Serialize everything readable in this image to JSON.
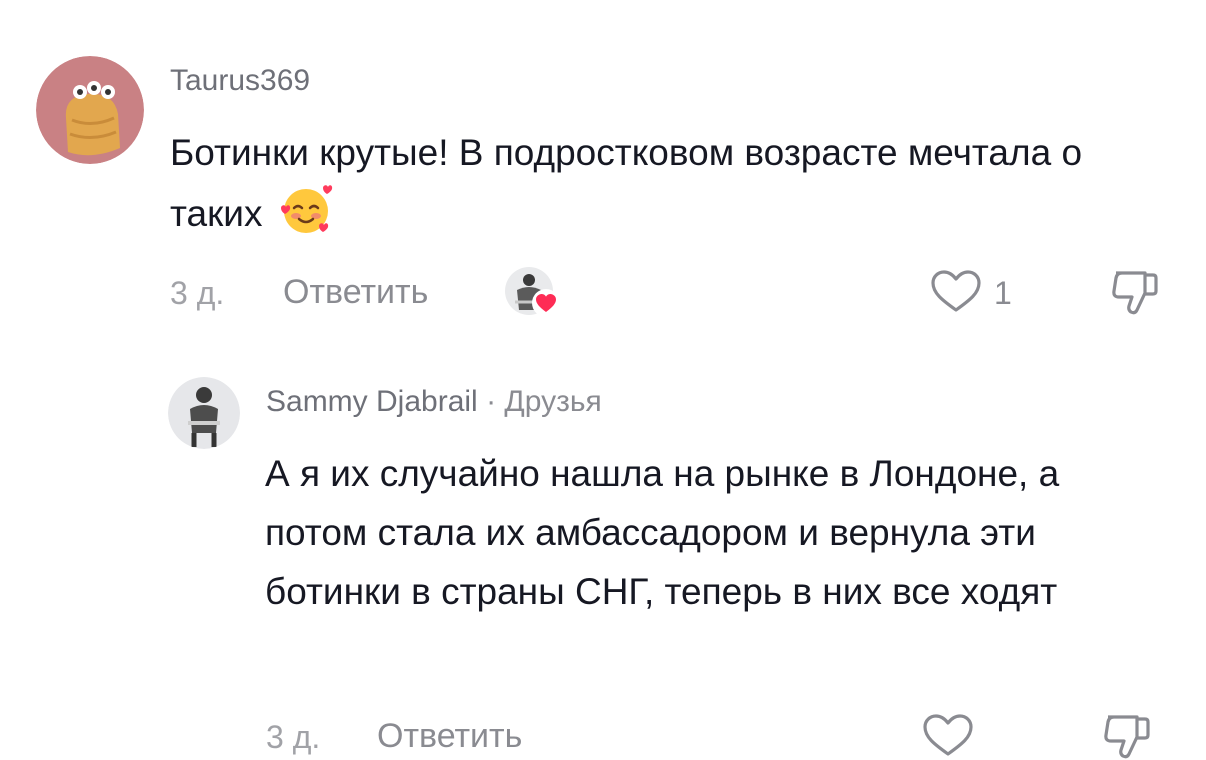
{
  "comments": [
    {
      "username": "Taurus369",
      "text": "Ботинки крутые! В подростковом возрасте мечтала о таких",
      "emoji": "smiling-face-with-hearts",
      "time": "3 д.",
      "reply_label": "Ответить",
      "like_count": "1",
      "avatar_bg": "#c98184"
    },
    {
      "username": "Sammy Djabrail",
      "separator": "·",
      "badge": "Друзья",
      "text": "А я их случайно нашла на рынке в Лондоне, а потом стала их амбассадором и вернула эти ботинки в страны СНГ, теперь в них все ходят",
      "time": "3 д.",
      "reply_label": "Ответить"
    }
  ],
  "colors": {
    "heart_badge": "#fe2c55",
    "icon_stroke": "#8a8b91"
  }
}
